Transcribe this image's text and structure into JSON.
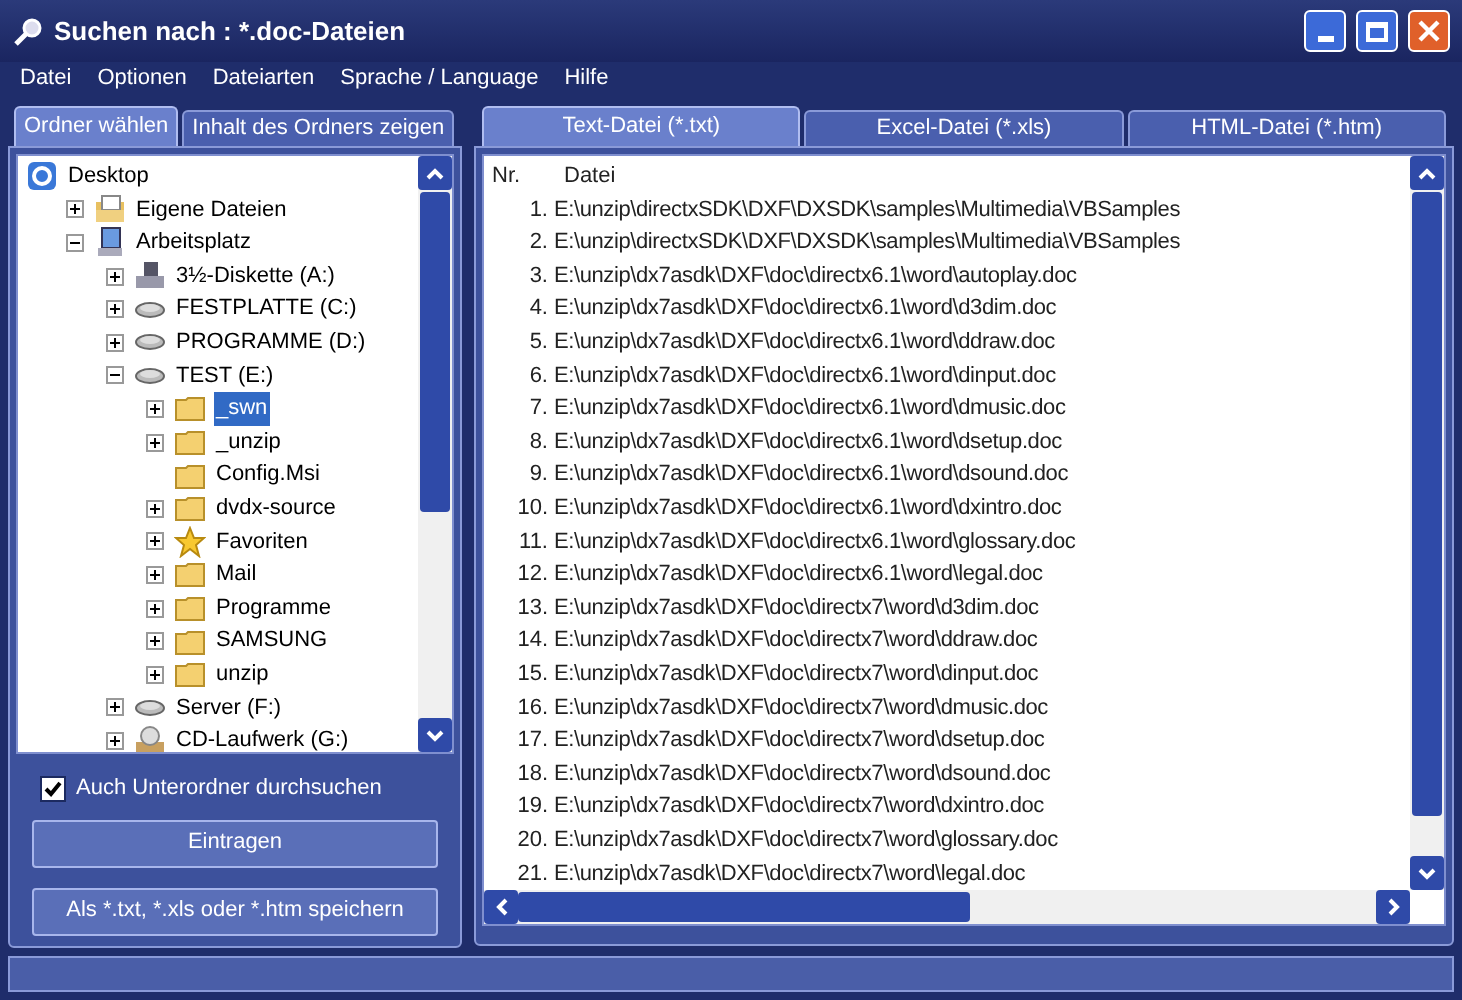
{
  "window": {
    "title": "Suchen nach : *.doc-Dateien"
  },
  "menu": [
    "Datei",
    "Optionen",
    "Dateiarten",
    "Sprache / Language",
    "Hilfe"
  ],
  "left_tabs": [
    {
      "label": "Ordner wählen",
      "selected": true
    },
    {
      "label": "Inhalt des Ordners zeigen",
      "selected": false
    }
  ],
  "tree": [
    {
      "label": "Desktop",
      "kind": "desktop",
      "selected": false,
      "children": [
        {
          "label": "Eigene Dateien",
          "kind": "documents",
          "expanded": false,
          "selected": false
        },
        {
          "label": "Arbeitsplatz",
          "kind": "computer",
          "expanded": true,
          "selected": false,
          "children": [
            {
              "label": "3½-Diskette (A:)",
              "kind": "floppy",
              "expanded": false,
              "selected": false
            },
            {
              "label": "FESTPLATTE (C:)",
              "kind": "drive",
              "expanded": false,
              "selected": false
            },
            {
              "label": "PROGRAMME (D:)",
              "kind": "drive",
              "expanded": false,
              "selected": false
            },
            {
              "label": "TEST (E:)",
              "kind": "drive",
              "expanded": true,
              "selected": false,
              "children": [
                {
                  "label": "_swn",
                  "kind": "folder",
                  "expanded": false,
                  "selected": true
                },
                {
                  "label": "_unzip",
                  "kind": "folder",
                  "expanded": false,
                  "selected": false
                },
                {
                  "label": "Config.Msi",
                  "kind": "folder",
                  "selected": false
                },
                {
                  "label": "dvdx-source",
                  "kind": "folder",
                  "expanded": false,
                  "selected": false
                },
                {
                  "label": "Favoriten",
                  "kind": "star",
                  "expanded": false,
                  "selected": false
                },
                {
                  "label": "Mail",
                  "kind": "folder",
                  "expanded": false,
                  "selected": false
                },
                {
                  "label": "Programme",
                  "kind": "folder",
                  "expanded": false,
                  "selected": false
                },
                {
                  "label": "SAMSUNG",
                  "kind": "folder",
                  "expanded": false,
                  "selected": false
                },
                {
                  "label": "unzip",
                  "kind": "folder",
                  "expanded": false,
                  "selected": false
                }
              ]
            },
            {
              "label": "Server (F:)",
              "kind": "drive",
              "expanded": false,
              "selected": false
            },
            {
              "label": "CD-Laufwerk (G:)",
              "kind": "cdrom",
              "expanded": false,
              "selected": false
            }
          ]
        }
      ]
    }
  ],
  "subfolders_checkbox": {
    "label": "Auch Unterordner durchsuchen",
    "checked": true
  },
  "buttons": [
    "Eintragen",
    "Als *.txt, *.xls oder *.htm speichern"
  ],
  "right_tabs": [
    {
      "label": "Text-Datei (*.txt)",
      "selected": true
    },
    {
      "label": "Excel-Datei (*.xls)",
      "selected": false
    },
    {
      "label": "HTML-Datei (*.htm)",
      "selected": false
    }
  ],
  "list": {
    "columns": [
      "Nr.",
      "Datei"
    ],
    "rows": [
      [
        "1.",
        "E:\\unzip\\directxSDK\\DXF\\DXSDK\\samples\\Multimedia\\VBSamples"
      ],
      [
        "2.",
        "E:\\unzip\\directxSDK\\DXF\\DXSDK\\samples\\Multimedia\\VBSamples"
      ],
      [
        "3.",
        "E:\\unzip\\dx7asdk\\DXF\\doc\\directx6.1\\word\\autoplay.doc"
      ],
      [
        "4.",
        "E:\\unzip\\dx7asdk\\DXF\\doc\\directx6.1\\word\\d3dim.doc"
      ],
      [
        "5.",
        "E:\\unzip\\dx7asdk\\DXF\\doc\\directx6.1\\word\\ddraw.doc"
      ],
      [
        "6.",
        "E:\\unzip\\dx7asdk\\DXF\\doc\\directx6.1\\word\\dinput.doc"
      ],
      [
        "7.",
        "E:\\unzip\\dx7asdk\\DXF\\doc\\directx6.1\\word\\dmusic.doc"
      ],
      [
        "8.",
        "E:\\unzip\\dx7asdk\\DXF\\doc\\directx6.1\\word\\dsetup.doc"
      ],
      [
        "9.",
        "E:\\unzip\\dx7asdk\\DXF\\doc\\directx6.1\\word\\dsound.doc"
      ],
      [
        "10.",
        "E:\\unzip\\dx7asdk\\DXF\\doc\\directx6.1\\word\\dxintro.doc"
      ],
      [
        "11.",
        "E:\\unzip\\dx7asdk\\DXF\\doc\\directx6.1\\word\\glossary.doc"
      ],
      [
        "12.",
        "E:\\unzip\\dx7asdk\\DXF\\doc\\directx6.1\\word\\legal.doc"
      ],
      [
        "13.",
        "E:\\unzip\\dx7asdk\\DXF\\doc\\directx7\\word\\d3dim.doc"
      ],
      [
        "14.",
        "E:\\unzip\\dx7asdk\\DXF\\doc\\directx7\\word\\ddraw.doc"
      ],
      [
        "15.",
        "E:\\unzip\\dx7asdk\\DXF\\doc\\directx7\\word\\dinput.doc"
      ],
      [
        "16.",
        "E:\\unzip\\dx7asdk\\DXF\\doc\\directx7\\word\\dmusic.doc"
      ],
      [
        "17.",
        "E:\\unzip\\dx7asdk\\DXF\\doc\\directx7\\word\\dsetup.doc"
      ],
      [
        "18.",
        "E:\\unzip\\dx7asdk\\DXF\\doc\\directx7\\word\\dsound.doc"
      ],
      [
        "19.",
        "E:\\unzip\\dx7asdk\\DXF\\doc\\directx7\\word\\dxintro.doc"
      ],
      [
        "20.",
        "E:\\unzip\\dx7asdk\\DXF\\doc\\directx7\\word\\glossary.doc"
      ],
      [
        "21.",
        "E:\\unzip\\dx7asdk\\DXF\\doc\\directx7\\word\\legal.doc"
      ]
    ]
  }
}
